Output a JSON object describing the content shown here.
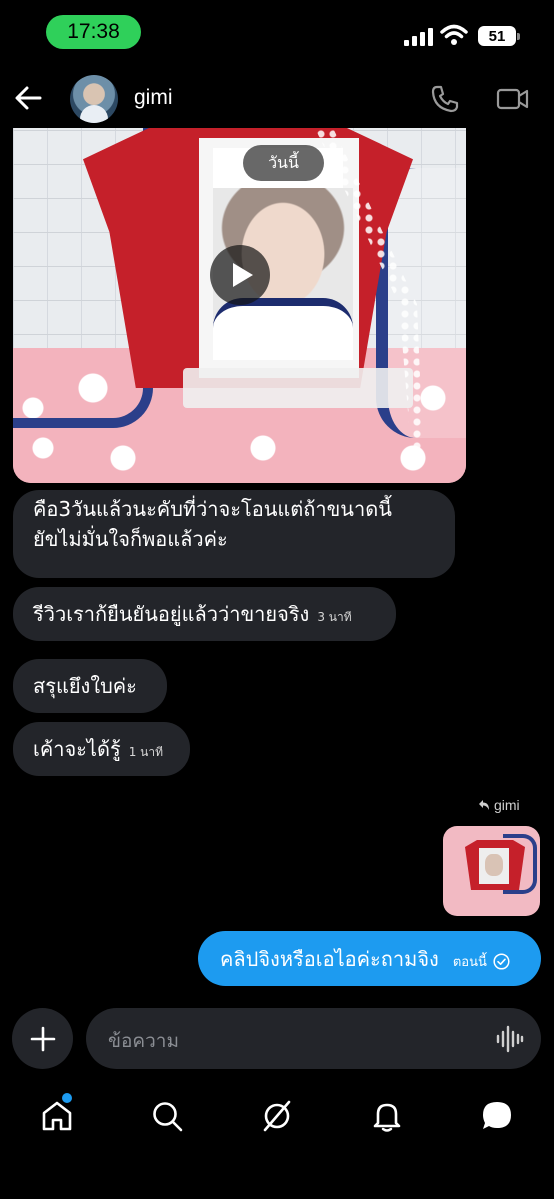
{
  "status_bar": {
    "time": "17:38",
    "battery": "51"
  },
  "header": {
    "contact_name": "gimi"
  },
  "media": {
    "date_label": "วันนี้"
  },
  "messages": [
    {
      "line1": "คือ3วันแล้วนะคับที่ว่าจะโอนแต่ถ้าขนาดนี้",
      "line2": "ยัขไม่มั่นใจก็พอแล้วค่ะ"
    },
    {
      "text": "รีวิวเราก้ยืนยันอยู่แล้วว่าขายจริง",
      "time": "3 นาที"
    },
    {
      "text": "สรุแยึงใบค่ะ"
    },
    {
      "text": "เค้าจะได้รู้",
      "time": "1 นาที"
    }
  ],
  "reply": {
    "label": "gimi"
  },
  "sent_message": {
    "text": "คลิปจิงหรือเอไอค่ะถามจิง",
    "time": "ตอนนี้"
  },
  "composer": {
    "placeholder": "ข้อความ"
  },
  "colors": {
    "accent": "#1d9bf0",
    "bubble": "#23252a",
    "status_pill": "#2fd05a"
  },
  "icons": [
    "back-arrow-icon",
    "phone-icon",
    "video-icon",
    "play-icon",
    "reply-arrow-icon",
    "check-circle-icon",
    "plus-icon",
    "audio-wave-icon",
    "home-icon",
    "search-icon",
    "grok-icon",
    "bell-icon",
    "chat-icon"
  ]
}
